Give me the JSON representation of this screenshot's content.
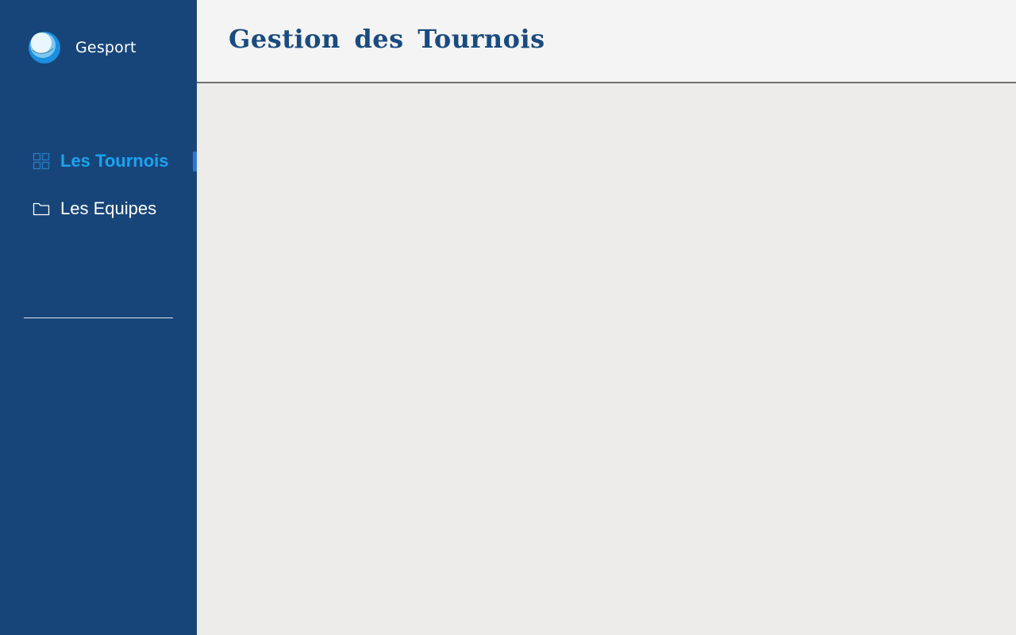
{
  "app": {
    "name": "Gesport"
  },
  "sidebar": {
    "items": [
      {
        "label": "Les Tournois",
        "icon": "grid-icon",
        "active": true
      },
      {
        "label": "Les Equipes",
        "icon": "folder-icon",
        "active": false
      }
    ]
  },
  "header": {
    "title": "Gestion des Tournois"
  },
  "colors": {
    "sidebar_bg": "#184579",
    "active_text": "#1aa3f0",
    "active_marker": "#2b7cc4",
    "title_text": "#194b80",
    "header_bg": "#f4f4f4",
    "content_bg": "#edecea"
  }
}
